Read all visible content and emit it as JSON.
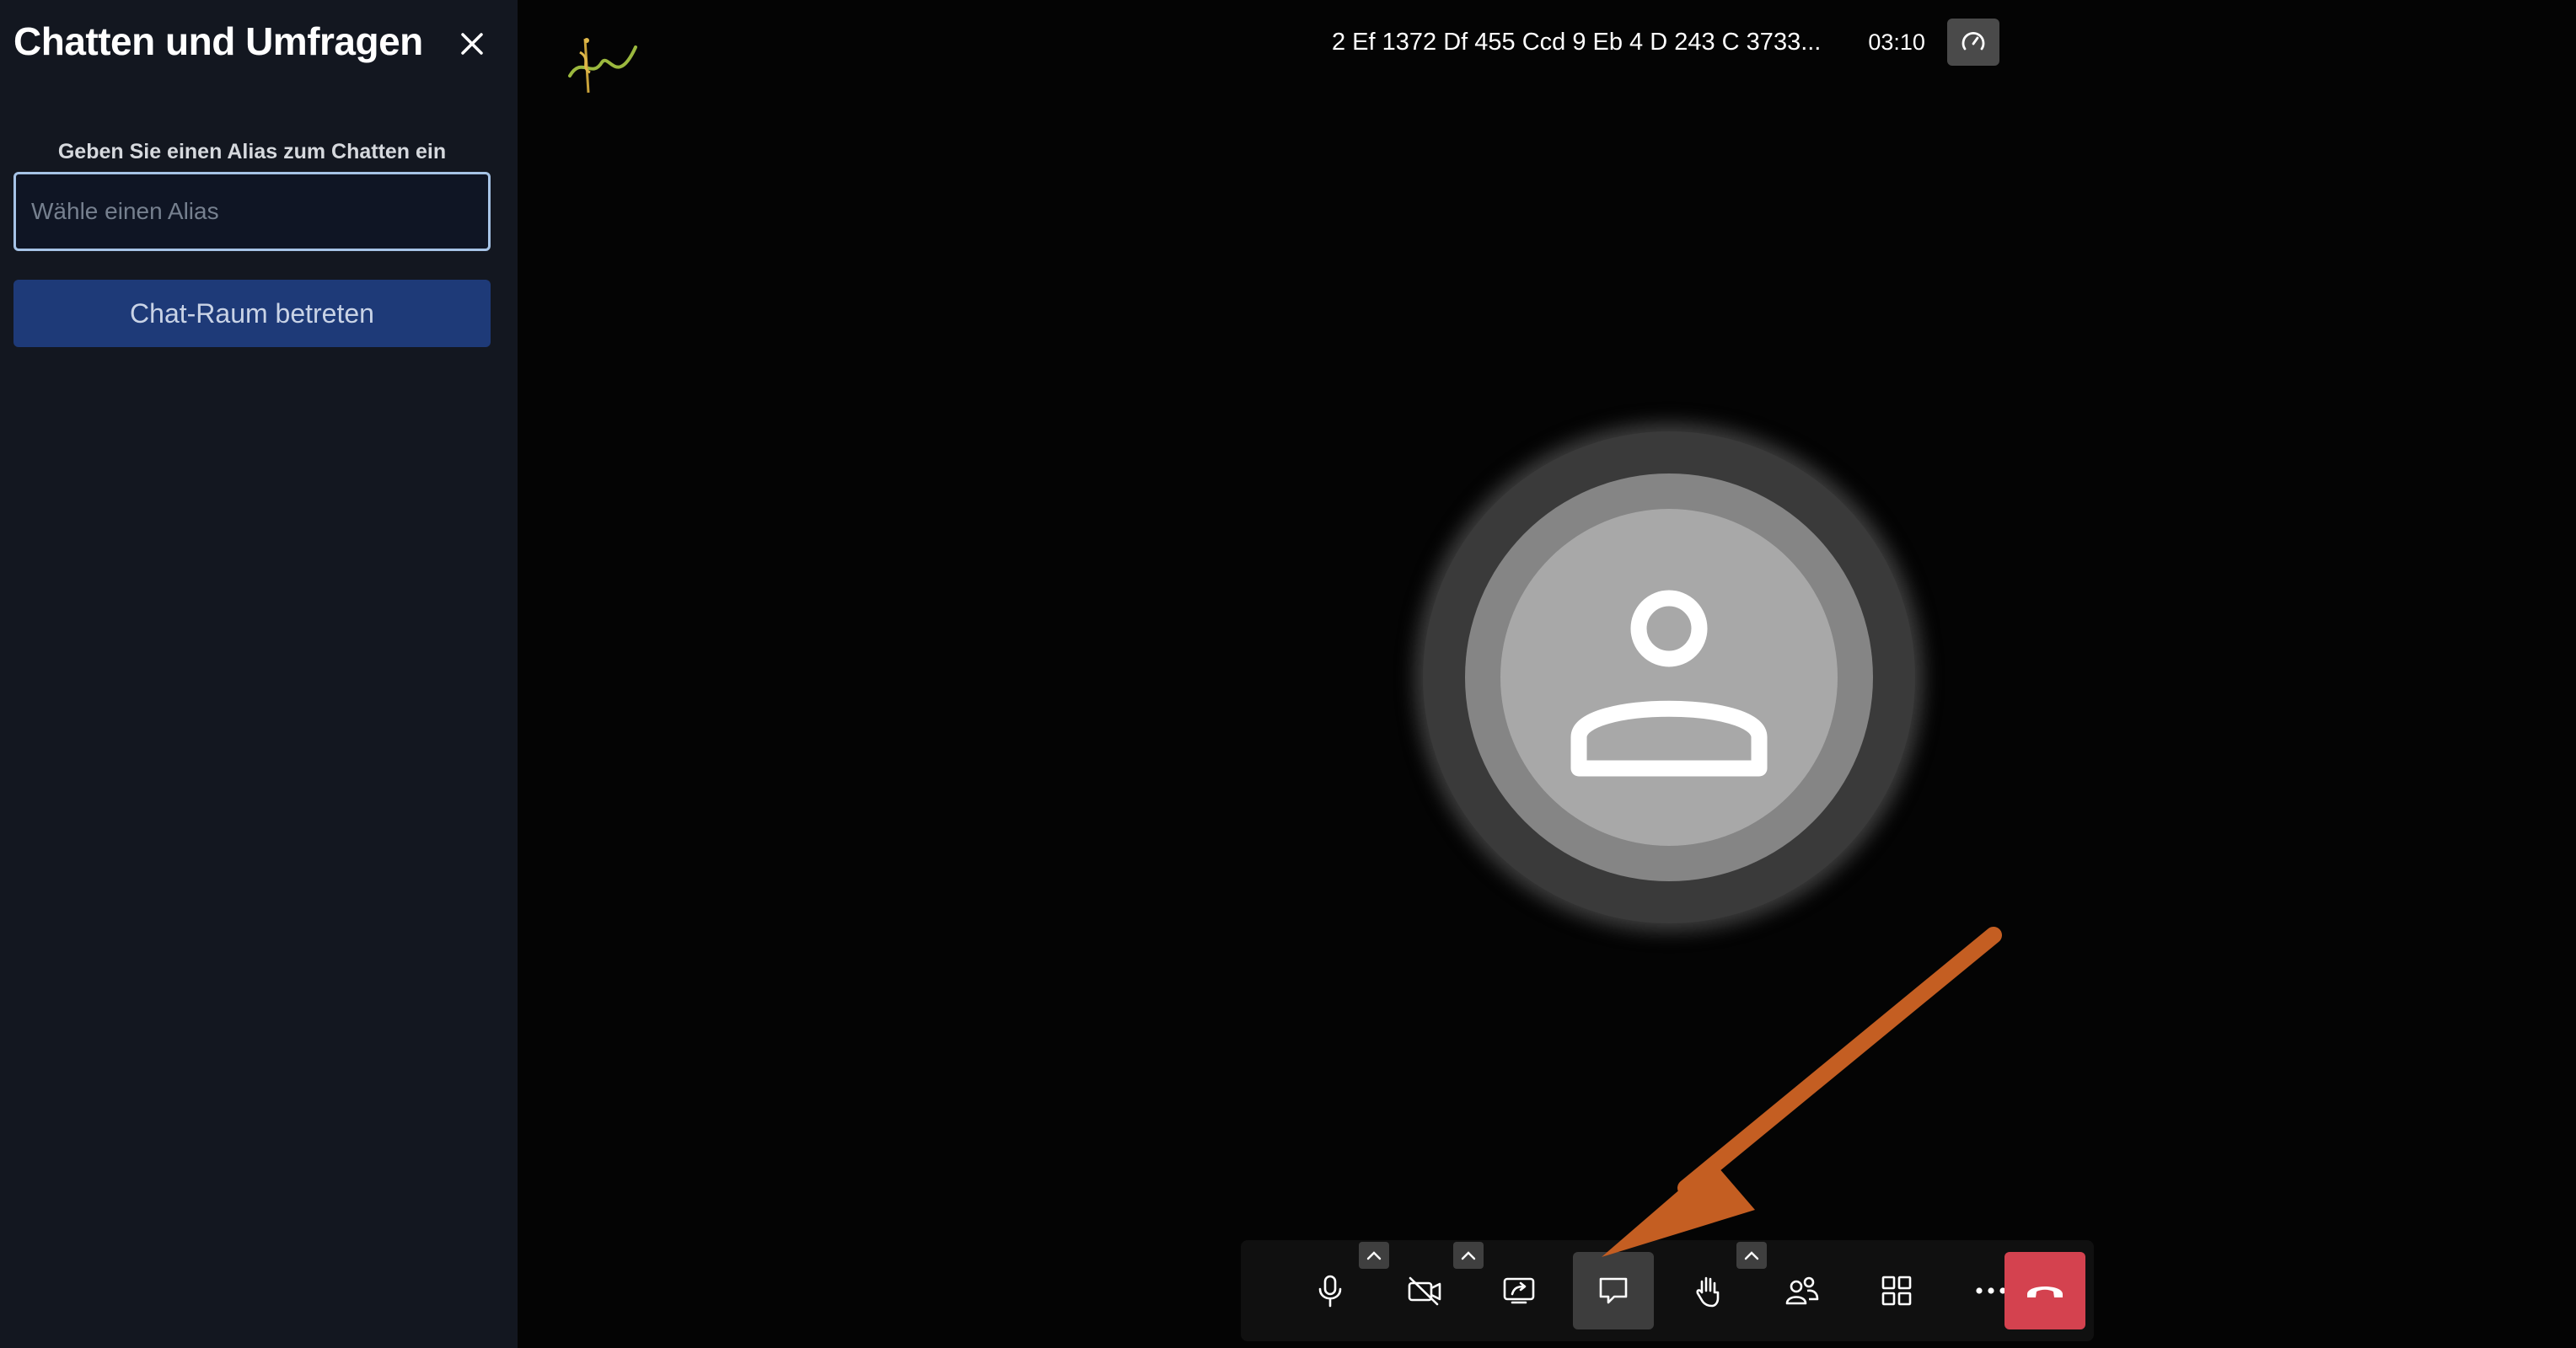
{
  "sidebar": {
    "title": "Chatten und Umfragen",
    "close_icon": "close-icon",
    "alias_label": "Geben Sie einen Alias zum Chatten ein",
    "alias_input": {
      "placeholder": "Wähle einen Alias",
      "value": ""
    },
    "join_button": "Chat-Raum betreten"
  },
  "header": {
    "meeting_name": "2 Ef 1372 Df 455 Ccd 9 Eb 4 D 243 C 3733...",
    "elapsed_time": "03:10",
    "performance_icon": "gauge-icon"
  },
  "toolbar": {
    "buttons": [
      {
        "name": "microphone",
        "icon": "microphone-icon",
        "has_menu": true
      },
      {
        "name": "camera",
        "icon": "camera-off-icon",
        "has_menu": true
      },
      {
        "name": "screen-share",
        "icon": "screen-share-icon",
        "has_menu": false
      },
      {
        "name": "chat",
        "icon": "chat-icon",
        "has_menu": false,
        "active": true
      },
      {
        "name": "raise-hand",
        "icon": "hand-icon",
        "has_menu": true
      },
      {
        "name": "participants",
        "icon": "participants-icon",
        "has_menu": false
      },
      {
        "name": "tile-view",
        "icon": "grid-icon",
        "has_menu": false
      },
      {
        "name": "more",
        "icon": "more-icon",
        "has_menu": false
      },
      {
        "name": "hangup",
        "icon": "hangup-icon",
        "has_menu": false
      }
    ]
  },
  "colors": {
    "sidebar_bg": "#131720",
    "stage_bg": "#040404",
    "join_button_bg": "#1e3a78",
    "hangup_bg": "#d4424f",
    "arrow": "#c45e22"
  }
}
